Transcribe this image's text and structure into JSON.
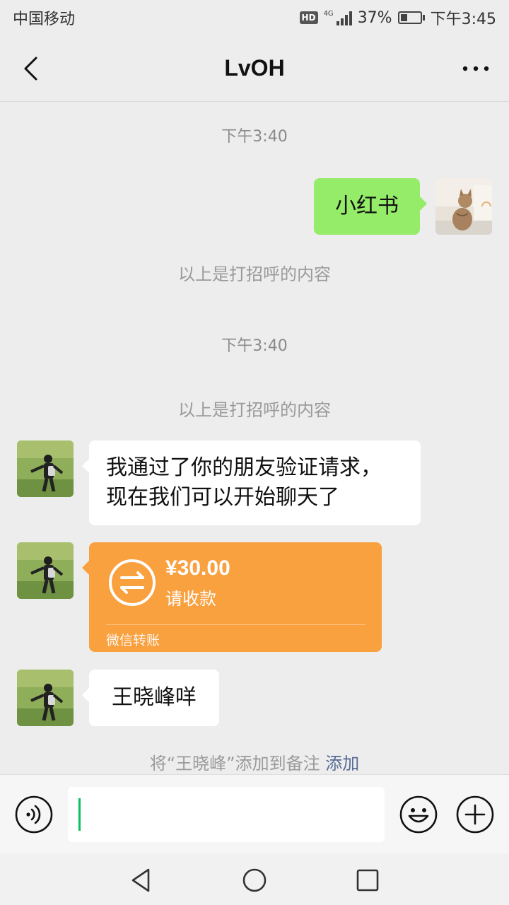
{
  "status_bar": {
    "carrier": "中国移动",
    "hd": "HD",
    "network": "4G",
    "battery": "37%",
    "battery_level": 0.37,
    "time": "下午3:45"
  },
  "nav": {
    "title": "LvOH"
  },
  "chat": {
    "time_1": "下午3:40",
    "msg_self_1": "小红书",
    "system_1": "以上是打招呼的内容",
    "time_2": "下午3:40",
    "system_2": "以上是打招呼的内容",
    "msg_other_1_line1": "我通过了你的朋友验证请求，",
    "msg_other_1_line2": "现在我们可以开始聊天了",
    "transfer": {
      "amount": "¥30.00",
      "status": "请收款",
      "footer": "微信转账"
    },
    "msg_other_2": "王晓峰咩",
    "remark_prefix": "将“王晓峰”添加到备注",
    "remark_link": "添加"
  },
  "colors": {
    "self_bubble": "#95ec69",
    "transfer": "#f9a03f",
    "link": "#576b95",
    "caret": "#07c160"
  },
  "icons": {
    "back": "back-arrow-icon",
    "more": "more-dots-icon",
    "voice": "voice-icon",
    "emoji": "emoji-icon",
    "plus": "plus-icon",
    "transfer": "transfer-arrows-icon"
  }
}
